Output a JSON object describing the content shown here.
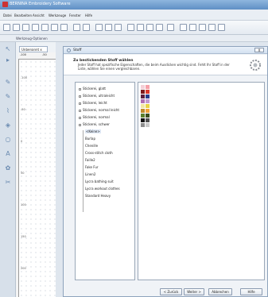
{
  "app": {
    "title": "BERNINA Embroidery Software"
  },
  "menu": [
    "Datei",
    "Bearbeiten",
    "Ansicht",
    "Werkzeuge",
    "Fenster",
    "Hilfe"
  ],
  "option_bar": {
    "label": "Werkzeug-Optionen"
  },
  "document": {
    "tab_label": "Unbenannt"
  },
  "ruler": {
    "h_ticks": [
      "-100",
      "-50"
    ],
    "v_ticks": [
      "-100",
      "-50",
      "0",
      "50",
      "100",
      "150",
      "200"
    ]
  },
  "dialog": {
    "title": "Stoff",
    "heading": "Zu bestickenden Stoff wählen",
    "description": "Jeder Stoff hat spezifische Eigenschaften, die beim Ausdicken wichtig sind. Fehlt Ihr Stoff in der Liste, wählen Sie einen vergleichbaren.",
    "close_label": "X",
    "tree_groups": [
      "Stickerei, glatt",
      "Stickerei, ultraleicht",
      "Stickerei, leicht",
      "Stickerei, normal leicht",
      "Stickerei, normal",
      "Stickerei, schwer"
    ],
    "tree_children": [
      "<Keine>",
      "Burlap",
      "Chenille",
      "Cross-stitch cloth",
      "Faille2",
      "Fake Fur",
      "Linen2",
      "Lycra bathing suit",
      "Lycra workout clothes",
      "Standard Heavy"
    ],
    "swatch_colors": [
      "#f4cfd6",
      "#f6a0a8",
      "#7b1a1c",
      "#d9382b",
      "#5b1f3d",
      "#2a3e8c",
      "#b06fb3",
      "#c29ad3",
      "#f2e6a3",
      "#e8d447",
      "#c08b2a",
      "#f0a23c",
      "#5b7f2c",
      "#3e4f1f",
      "#101010",
      "#4f4f4f",
      "#8c8c8c",
      "#c9c9c9"
    ],
    "buttons": {
      "back": "< Zurück",
      "next": "Weiter >",
      "cancel": "Abbrechen",
      "help": "Hilfe"
    }
  }
}
